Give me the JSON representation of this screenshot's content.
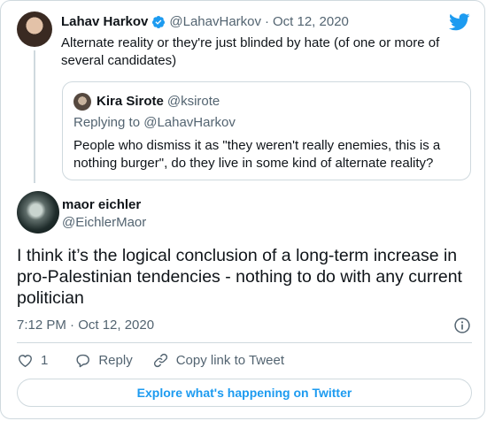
{
  "parent": {
    "name": "Lahav Harkov",
    "handle": "@LahavHarkov",
    "separator": "·",
    "date": "Oct 12, 2020",
    "text": "Alternate reality or they're just blinded by hate (of one or more of several candidates)"
  },
  "quote": {
    "name": "Kira Sirote",
    "handle": "@ksirote",
    "replying_to": "Replying to @LahavHarkov",
    "text": "People who dismiss it as \"they weren't really enemies, this is a nothing burger\", do they live in some kind of alternate reality?"
  },
  "main": {
    "name": "maor eichler",
    "handle": "@EichlerMaor",
    "text": "I think it’s the logical conclusion of a long-term increase in pro-Palestinian tendencies - nothing to do with any current politician",
    "timestamp": "7:12 PM · Oct 12, 2020"
  },
  "actions": {
    "like_count": "1",
    "reply_label": "Reply",
    "copy_link_label": "Copy link to Tweet"
  },
  "footer": {
    "explore_label": "Explore what's happening on Twitter"
  },
  "colors": {
    "accent": "#1d9bf0",
    "secondary_text": "#536471",
    "border": "#cfd9de"
  },
  "icons": [
    "verified-badge-icon",
    "twitter-bird-icon",
    "info-icon",
    "heart-icon",
    "reply-bubble-icon",
    "link-icon"
  ]
}
